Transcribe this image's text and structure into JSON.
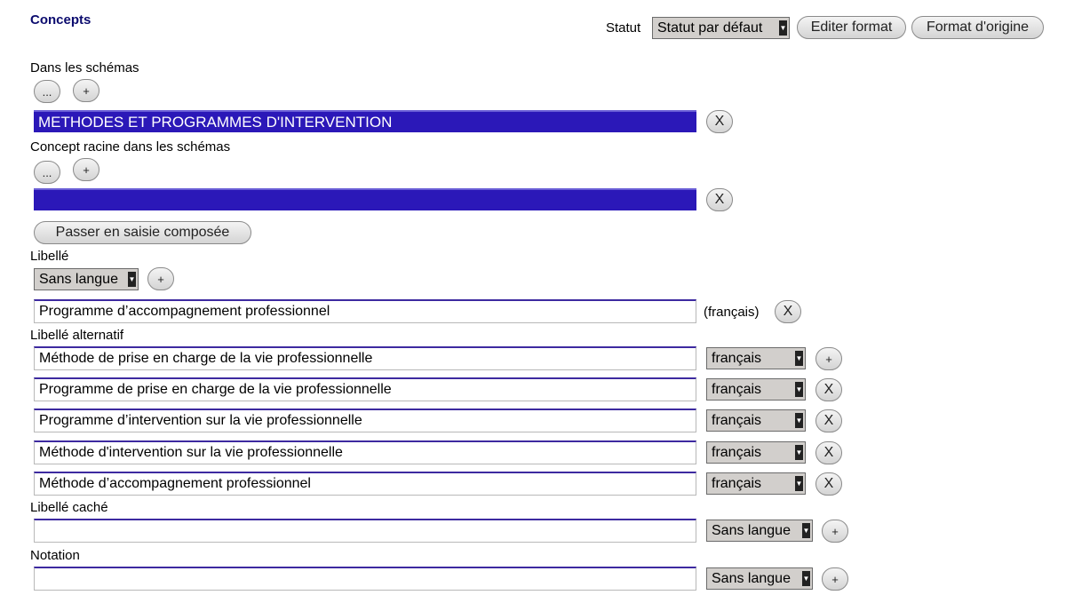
{
  "header": {
    "title": "Concepts",
    "statut_label": "Statut",
    "statut_value": "Statut par défaut",
    "edit_format": "Editer format",
    "original_format": "Format d'origine"
  },
  "schemes": {
    "label": "Dans les schémas",
    "browse": "...",
    "add": "+",
    "value": "METHODES ET PROGRAMMES D'INTERVENTION",
    "remove": "X"
  },
  "root_schemes": {
    "label": "Concept racine dans les schémas",
    "browse": "...",
    "add": "+",
    "value": "",
    "remove": "X"
  },
  "composed_button": "Passer en saisie composée",
  "pref_label": {
    "label": "Libellé",
    "lang_select": "Sans langue",
    "add": "+",
    "value": "Programme d’accompagnement professionnel",
    "lang_text": "(français)",
    "remove": "X"
  },
  "alt_labels": {
    "label": "Libellé alternatif",
    "items": [
      {
        "value": "Méthode de prise en charge de la vie professionnelle",
        "lang": "français",
        "action": "+"
      },
      {
        "value": "Programme de prise en charge de la vie professionnelle",
        "lang": "français",
        "action": "X"
      },
      {
        "value": "Programme d’intervention sur la vie professionnelle",
        "lang": "français",
        "action": "X"
      },
      {
        "value": "Méthode d'intervention sur la vie professionnelle",
        "lang": "français",
        "action": "X"
      },
      {
        "value": "Méthode d’accompagnement professionnel",
        "lang": "français",
        "action": "X"
      }
    ]
  },
  "hidden_label": {
    "label": "Libellé caché",
    "value": "",
    "lang": "Sans langue",
    "add": "+"
  },
  "notation": {
    "label": "Notation",
    "value": "",
    "lang": "Sans langue",
    "add": "+"
  }
}
